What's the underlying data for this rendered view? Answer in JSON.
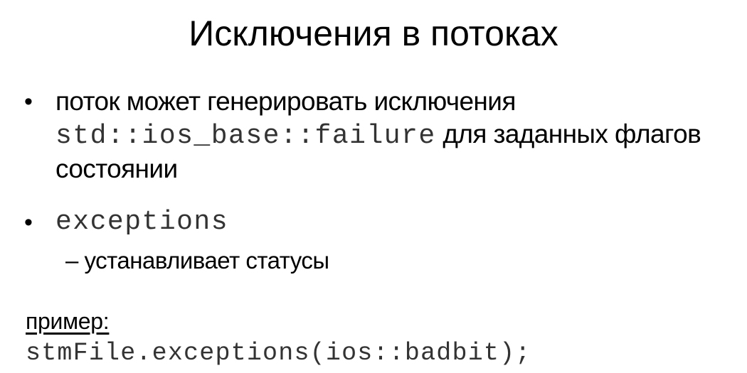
{
  "slide": {
    "title": "Исключения в потоках",
    "bullets": [
      {
        "marker": "•",
        "text_before": "поток может генерировать исключения ",
        "code": "std::ios_base::failure",
        "text_after": " для заданных флагов состоянии"
      },
      {
        "marker": "•",
        "code": "exceptions",
        "sub_items": [
          {
            "dash": "–",
            "text": "устанавливает статусы"
          }
        ]
      }
    ],
    "example": {
      "label": "пример:",
      "code": "stmFile.exceptions(ios::badbit);"
    }
  }
}
